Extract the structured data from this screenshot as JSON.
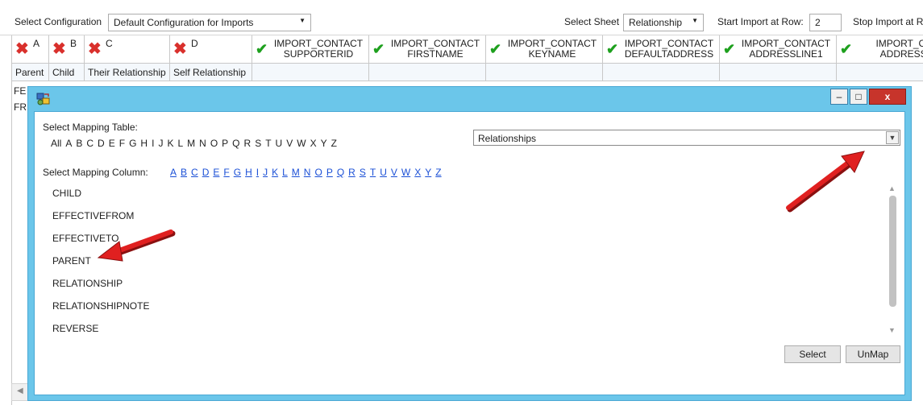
{
  "toolbar": {
    "config_label": "Select Configuration",
    "config_value": "Default Configuration for Imports",
    "sheet_label": "Select Sheet",
    "sheet_value": "Relationship",
    "start_label": "Start Import at Row:",
    "start_value": "2",
    "stop_label": "Stop Import at R"
  },
  "grid": {
    "columns": [
      {
        "letter": "A",
        "status": "error",
        "field1": "Parent"
      },
      {
        "letter": "B",
        "status": "error",
        "field1": "Child"
      },
      {
        "letter": "C",
        "status": "error",
        "field1": "Their Relationship"
      },
      {
        "letter": "D",
        "status": "error",
        "field1": "Self Relationship"
      },
      {
        "status": "ok",
        "import_line1": "IMPORT_CONTACT",
        "import_line2": "SUPPORTERID"
      },
      {
        "status": "ok",
        "import_line1": "IMPORT_CONTACT",
        "import_line2": "FIRSTNAME"
      },
      {
        "status": "ok",
        "import_line1": "IMPORT_CONTACT",
        "import_line2": "KEYNAME"
      },
      {
        "status": "ok",
        "import_line1": "IMPORT_CONTACT",
        "import_line2": "DEFAULTADDRESS"
      },
      {
        "status": "ok",
        "import_line1": "IMPORT_CONTACT",
        "import_line2": "ADDRESSLINE1"
      },
      {
        "status": "ok",
        "import_line1": "IMPORT_CONT",
        "import_line2": "ADDRESSLIN"
      }
    ],
    "rows": [
      "FE",
      "FR"
    ]
  },
  "dialog": {
    "icon": "app-icon",
    "mapping_table_label": "Select Mapping Table:",
    "table_letters": [
      "All",
      "A",
      "B",
      "C",
      "D",
      "E",
      "F",
      "G",
      "H",
      "I",
      "J",
      "K",
      "L",
      "M",
      "N",
      "O",
      "P",
      "Q",
      "R",
      "S",
      "T",
      "U",
      "V",
      "W",
      "X",
      "Y",
      "Z"
    ],
    "mapping_table_value": "Relationships",
    "mapping_column_label": "Select Mapping Column:",
    "column_letters": [
      "A",
      "B",
      "C",
      "D",
      "E",
      "F",
      "G",
      "H",
      "I",
      "J",
      "K",
      "L",
      "M",
      "N",
      "O",
      "P",
      "Q",
      "R",
      "S",
      "T",
      "U",
      "V",
      "W",
      "X",
      "Y",
      "Z"
    ],
    "columns": [
      "CHILD",
      "EFFECTIVEFROM",
      "EFFECTIVETO",
      "PARENT",
      "RELATIONSHIP",
      "RELATIONSHIPNOTE",
      "REVERSE"
    ],
    "select_button": "Select",
    "unmap_button": "UnMap",
    "minimize": "–",
    "maximize": "□",
    "close": "x"
  },
  "colors": {
    "dialog_frame": "#6bc6ea",
    "error": "#d9302c",
    "ok": "#1ea01e",
    "link": "#1a4fd6",
    "annotation_arrow": "#e02020"
  }
}
